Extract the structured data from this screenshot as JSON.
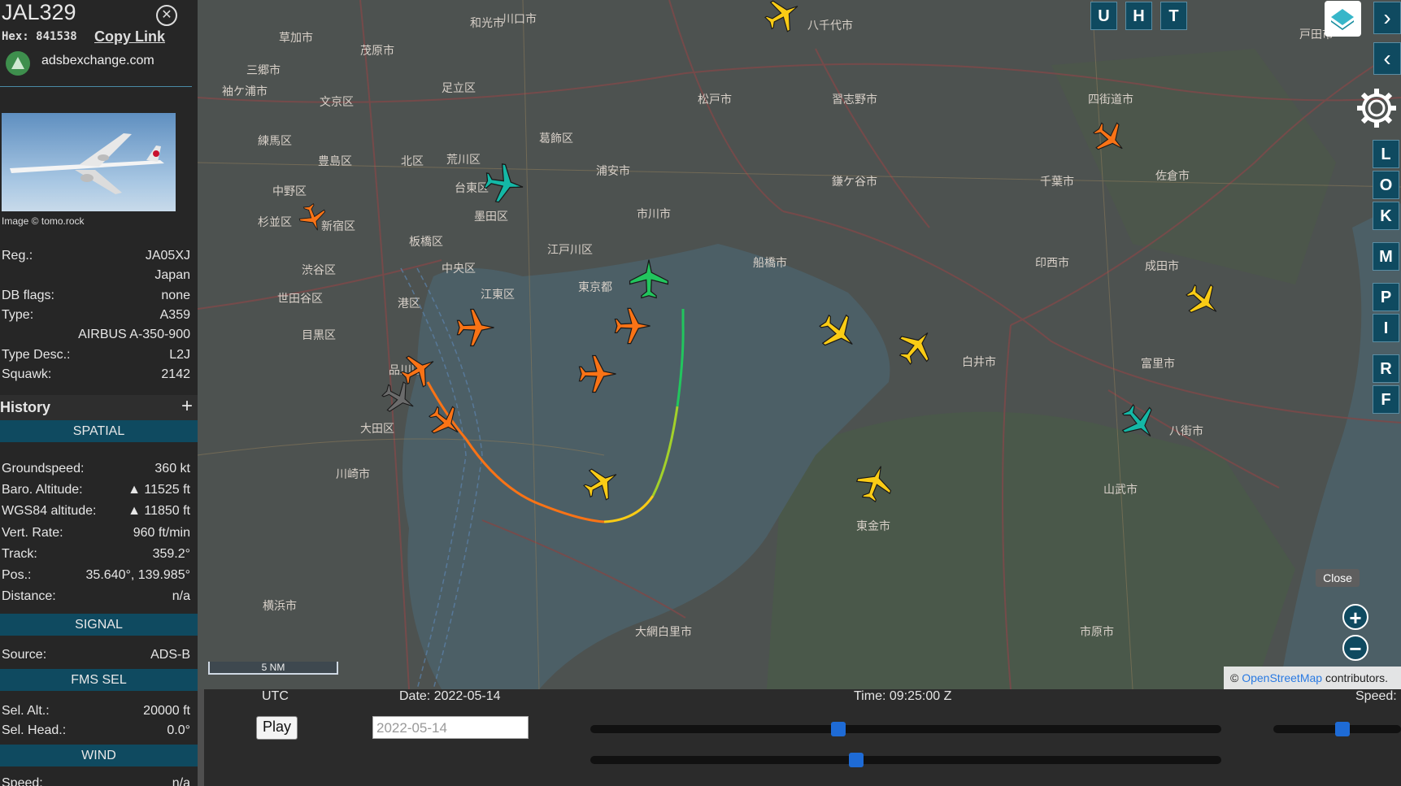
{
  "aircraft": {
    "callsign": "JAL329",
    "hex_label": "Hex:",
    "hex": "841538",
    "copy_link": "Copy Link",
    "source_site": "adsbexchange.com",
    "image_credit": "Image © tomo.rock"
  },
  "details": [
    {
      "key": "Reg.:",
      "value": "JA05XJ"
    },
    {
      "key": "",
      "value": "Japan"
    },
    {
      "key": "DB flags:",
      "value": "none"
    },
    {
      "key": "Type:",
      "value": "A359"
    },
    {
      "key": "",
      "value": "AIRBUS A-350-900"
    },
    {
      "key": "Type Desc.:",
      "value": "L2J"
    },
    {
      "key": "Squawk:",
      "value": "2142"
    }
  ],
  "history_label": "History",
  "history_plus": "+",
  "sections": {
    "spatial": "SPATIAL",
    "signal": "SIGNAL",
    "fms": "FMS SEL",
    "wind": "WIND"
  },
  "spatial": [
    {
      "key": "Groundspeed:",
      "value": "360 kt"
    },
    {
      "key": "Baro. Altitude:",
      "value": "▲ 11525 ft"
    },
    {
      "key": "WGS84 altitude:",
      "value": "▲ 11850 ft"
    },
    {
      "key": "Vert. Rate:",
      "value": "960 ft/min"
    },
    {
      "key": "Track:",
      "value": "359.2°"
    },
    {
      "key": "Pos.:",
      "value": "35.640°, 139.985°"
    },
    {
      "key": "Distance:",
      "value": "n/a"
    }
  ],
  "signal": [
    {
      "key": "Source:",
      "value": "ADS-B"
    }
  ],
  "fms": [
    {
      "key": "Sel. Alt.:",
      "value": "20000 ft"
    },
    {
      "key": "Sel. Head.:",
      "value": "0.0°"
    }
  ],
  "wind": [
    {
      "key": "Speed:",
      "value": "n/a"
    }
  ],
  "map": {
    "labels": [
      "練馬区",
      "杉並区",
      "世田谷区",
      "目黒区",
      "中野区",
      "豊島区",
      "新宿区",
      "渋谷区",
      "港区",
      "品川区",
      "大田区",
      "川崎市",
      "横浜市",
      "足立区",
      "荒川区",
      "台東区",
      "墨田区",
      "江東区",
      "中央区",
      "江戸川区",
      "葛飾区",
      "北区",
      "文京区",
      "板橋区",
      "東京都",
      "浦安市",
      "市川市",
      "松戸市",
      "船橋市",
      "習志野市",
      "鎌ケ谷市",
      "八千代市",
      "白井市",
      "印西市",
      "千葉市",
      "四街道市",
      "佐倉市",
      "成田市",
      "富里市",
      "八街市",
      "山武市",
      "東金市",
      "大網白里市",
      "市原市",
      "袖ケ浦市",
      "茂原市",
      "和光市",
      "川口市",
      "草加市",
      "三郷市",
      "戸田市"
    ],
    "top_buttons": [
      "U",
      "H",
      "T"
    ],
    "side_buttons": [
      "L",
      "O",
      "K",
      "M",
      "P",
      "I",
      "R",
      "F"
    ],
    "close_label": "Close",
    "zoom_in": "+",
    "zoom_out": "−",
    "scale": "5 NM",
    "attribution_prefix": "©",
    "attribution_link": "OpenStreetMap",
    "attribution_suffix": "contributors.",
    "colors": {
      "selected": "#22c55e",
      "orange": "#f97316",
      "gold": "#facc15",
      "teal": "#14b8a6",
      "grey": "#6b6b6b",
      "accent": "#0f4a60"
    }
  },
  "playback": {
    "utc_label": "UTC",
    "date_label": "Date: 2022-05-14",
    "time_label": "Time: 09:25:00 Z",
    "speed_label": "Speed:",
    "play": "Play",
    "date_value": "2022-05-14",
    "time_slider_fraction": 0.39,
    "second_slider_fraction": 0.42,
    "speed_slider_fraction": 0.55
  }
}
